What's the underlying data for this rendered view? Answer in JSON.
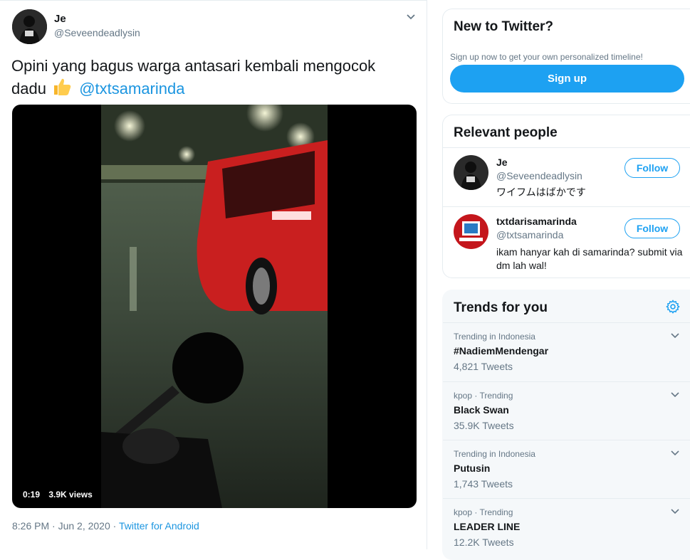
{
  "tweet": {
    "author_name": "Je",
    "author_handle": "@Seveendeadlysin",
    "text_before": "Opini yang bagus warga antasari kembali mengocok dadu",
    "mention": "@txtsamarinda",
    "video": {
      "duration": "0:19",
      "views": "3.9K views"
    },
    "timestamp": "8:26 PM · Jun 2, 2020",
    "source": "Twitter for Android"
  },
  "new_to_twitter": {
    "title": "New to Twitter?",
    "subtitle": "Sign up now to get your own personalized timeline!",
    "signup_label": "Sign up"
  },
  "relevant_people": {
    "title": "Relevant people",
    "people": [
      {
        "name": "Je",
        "handle": "@Seveendeadlysin",
        "bio": "ワイフムはばかです",
        "follow_label": "Follow"
      },
      {
        "name": "txtdarisamarinda",
        "handle": "@txtsamarinda",
        "bio": "ikam hanyar kah di samarinda? submit via dm lah wal!",
        "follow_label": "Follow"
      }
    ]
  },
  "trends": {
    "title": "Trends for you",
    "items": [
      {
        "context": "Trending in Indonesia",
        "name": "#NadiemMendengar",
        "count": "4,821 Tweets"
      },
      {
        "context": "kpop · Trending",
        "name": "Black Swan",
        "count": "35.9K Tweets"
      },
      {
        "context": "Trending in Indonesia",
        "name": "Putusin",
        "count": "1,743 Tweets"
      },
      {
        "context": "kpop · Trending",
        "name": "LEADER LINE",
        "count": "12.2K Tweets"
      }
    ]
  },
  "colors": {
    "accent": "#1da1f2",
    "link": "#1b95e0",
    "secondary_text": "#657786",
    "border": "#e6ecf0",
    "trends_bg": "#f5f8fa"
  }
}
